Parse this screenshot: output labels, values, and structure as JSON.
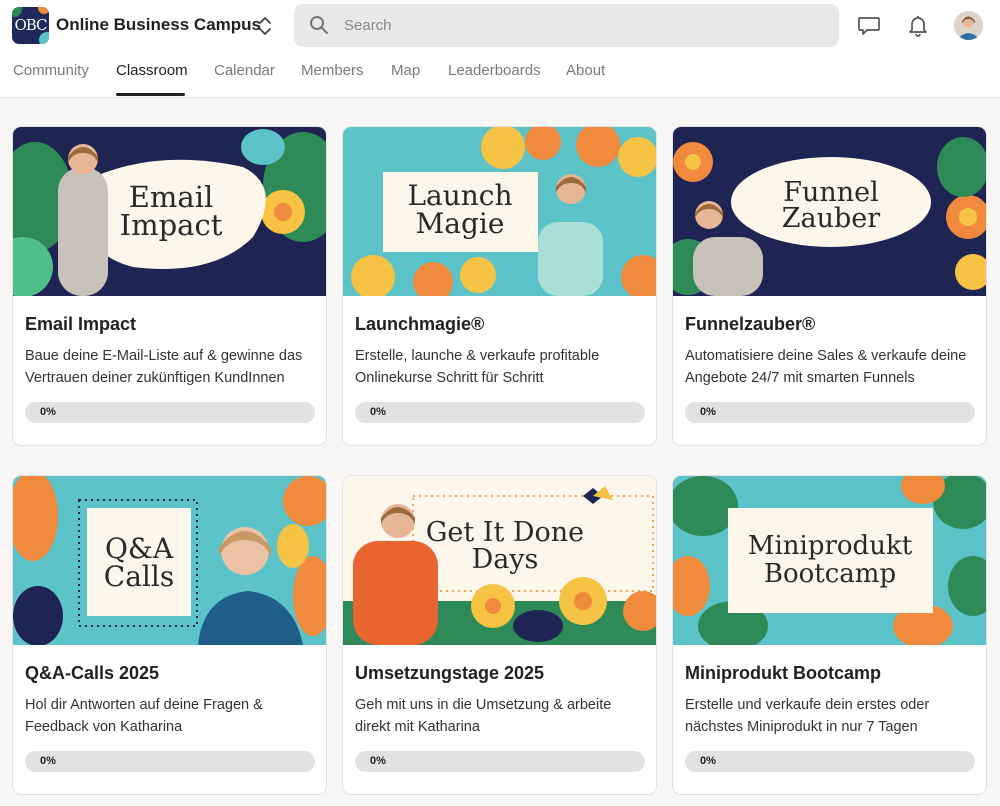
{
  "app": {
    "name": "Online Business Campus",
    "logo_text": "OBC"
  },
  "search": {
    "placeholder": "Search"
  },
  "tabs": [
    {
      "label": "Community"
    },
    {
      "label": "Classroom",
      "active": true
    },
    {
      "label": "Calendar"
    },
    {
      "label": "Members"
    },
    {
      "label": "Map"
    },
    {
      "label": "Leaderboards"
    },
    {
      "label": "About"
    }
  ],
  "courses": [
    {
      "title": "Email Impact",
      "description": "Baue deine E-Mail-Liste auf & gewinne das Vertrauen deiner zukünftigen KundInnen",
      "progress": 0,
      "progress_label": "0%",
      "banner_line1": "Email",
      "banner_line2": "Impact",
      "banner_bg": "#1f2553"
    },
    {
      "title": "Launchmagie®",
      "description": "Erstelle, launche & verkaufe profitable Onlinekurse Schritt für Schritt",
      "progress": 0,
      "progress_label": "0%",
      "banner_line1": "Launch",
      "banner_line2": "Magie",
      "banner_bg": "#5cc3c9"
    },
    {
      "title": "Funnelzauber®",
      "description": "Automatisiere deine Sales & verkaufe deine Angebote 24/7 mit smarten Funnels",
      "progress": 0,
      "progress_label": "0%",
      "banner_line1": "Funnel",
      "banner_line2": "Zauber",
      "banner_bg": "#1f2553"
    },
    {
      "title": "Q&A-Calls 2025",
      "description": "Hol dir Antworten auf deine Fragen & Feedback von Katharina",
      "progress": 0,
      "progress_label": "0%",
      "banner_line1": "Q&A",
      "banner_line2": "Calls",
      "banner_bg": "#5cc3c9"
    },
    {
      "title": "Umsetzungstage 2025",
      "description": "Geh mit uns in die Umsetzung & arbeite direkt mit Katharina",
      "progress": 0,
      "progress_label": "0%",
      "banner_line1": "Get It Done",
      "banner_line2": "Days",
      "banner_bg": "#fdf6ea"
    },
    {
      "title": "Miniprodukt Bootcamp",
      "description": "Erstelle und verkaufe dein erstes oder nächstes Miniprodukt in nur 7 Tagen",
      "progress": 0,
      "progress_label": "0%",
      "banner_line1": "Miniprodukt",
      "banner_line2": "Bootcamp",
      "banner_bg": "#5cc3c9"
    }
  ],
  "colors": {
    "navy": "#1f2553",
    "teal": "#5cc3c9",
    "orange": "#f08a3c",
    "yellow": "#f6c344",
    "green": "#2e8b57",
    "cream": "#fdf6ea",
    "progress_track": "#e2e2e2"
  },
  "icons": {
    "switch": "chevron-up-down-icon",
    "search": "search-icon",
    "chat": "chat-bubble-icon",
    "notifications": "bell-icon",
    "user": "avatar"
  }
}
